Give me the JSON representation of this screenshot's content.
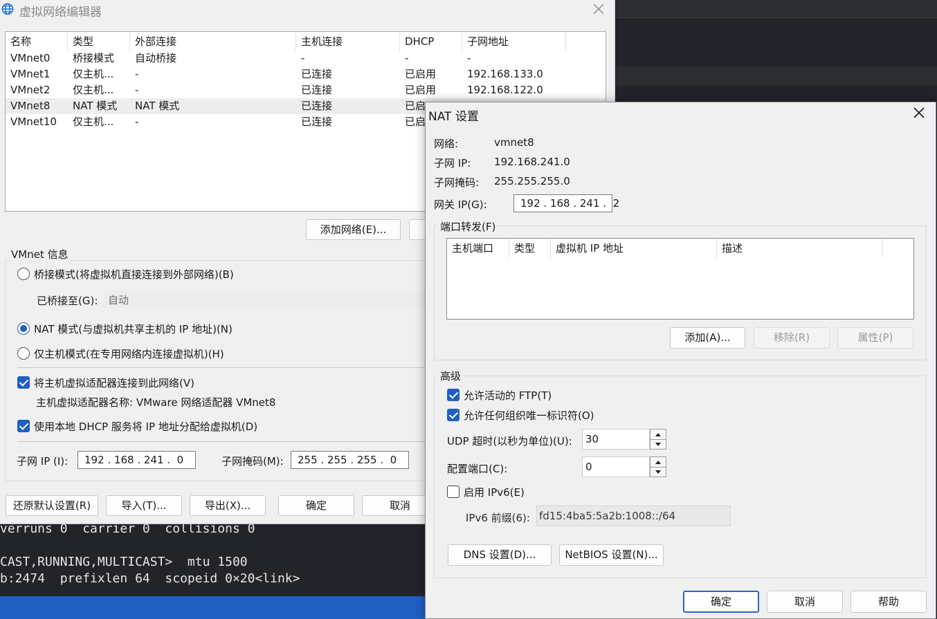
{
  "terminal": {
    "lines": [
      "verruns 0  carrier 0  collisions 0",
      "CAST,RUNNING,MULTICAST>  mtu 1500",
      "b:2474  prefixlen 64  scopeid 0×20<link>"
    ]
  },
  "vne": {
    "title": "虚拟网络编辑器",
    "icons": {
      "app": "globe-icon",
      "close": "close-icon"
    },
    "table": {
      "headers": [
        "名称",
        "类型",
        "外部连接",
        "主机连接",
        "DHCP",
        "子网地址"
      ],
      "rows": [
        [
          "VMnet0",
          "桥接模式",
          "自动桥接",
          "-",
          "-",
          "-"
        ],
        [
          "VMnet1",
          "仅主机...",
          "-",
          "已连接",
          "已启用",
          "192.168.133.0"
        ],
        [
          "VMnet2",
          "仅主机...",
          "-",
          "已连接",
          "已启用",
          "192.168.122.0"
        ],
        [
          "VMnet8",
          "NAT 模式",
          "NAT 模式",
          "已连接",
          "已启",
          ""
        ],
        [
          "VMnet10",
          "仅主机...",
          "-",
          "已连接",
          "已启",
          ""
        ]
      ],
      "selected_index": 3
    },
    "add_network_button": "添加网络(E)...",
    "info_group_label": "VMnet 信息",
    "bridged_radio": "桥接模式(将虚拟机直接连接到外部网络)(B)",
    "bridged_to_label": "已桥接至(G):",
    "bridged_to_value": "自动",
    "nat_radio": "NAT 模式(与虚拟机共享主机的 IP 地址)(N)",
    "hostonly_radio": "仅主机模式(在专用网络内连接虚拟机)(H)",
    "connect_adapter_check": "将主机虚拟适配器连接到此网络(V)",
    "adapter_name_text": "主机虚拟适配器名称: VMware 网络适配器 VMnet8",
    "dhcp_check": "使用本地 DHCP 服务将 IP 地址分配给虚拟机(D)",
    "subnet_ip_label": "子网 IP (I):",
    "subnet_ip_value": "192 . 168 . 241 .  0",
    "subnet_mask_label": "子网掩码(M):",
    "subnet_mask_value": "255 . 255 . 255 .  0",
    "bottom_buttons": {
      "restore": "还原默认设置(R)",
      "import": "导入(T)...",
      "export": "导出(X)...",
      "ok": "确定",
      "cancel": "取消"
    }
  },
  "nat": {
    "title": "NAT 设置",
    "network_label": "网络:",
    "network_value": "vmnet8",
    "subnet_ip_label": "子网 IP:",
    "subnet_ip_value": "192.168.241.0",
    "subnet_mask_label": "子网掩码:",
    "subnet_mask_value": "255.255.255.0",
    "gateway_label": "网关 IP(G):",
    "gateway_value": "192 . 168 . 241 .  2",
    "port_forward_label": "端口转发(F)",
    "pf_headers": [
      "主机端口",
      "类型",
      "虚拟机 IP 地址",
      "描述"
    ],
    "pf_add": "添加(A)...",
    "pf_remove": "移除(R)",
    "pf_props": "属性(P)",
    "advanced_label": "高级",
    "allow_ftp": "允许活动的 FTP(T)",
    "allow_oui": "允许任何组织唯一标识符(O)",
    "udp_timeout_label": "UDP 超时(以秒为单位)(U):",
    "udp_timeout_value": "30",
    "config_port_label": "配置端口(C):",
    "config_port_value": "0",
    "enable_ipv6": "启用 IPv6(E)",
    "ipv6_prefix_label": "IPv6 前缀(6):",
    "ipv6_prefix_value": "fd15:4ba5:5a2b:1008::/64",
    "dns_button": "DNS 设置(D)...",
    "netbios_button": "NetBIOS 设置(N)...",
    "ok": "确定",
    "cancel": "取消",
    "help": "帮助",
    "accent": "#1f5fc2"
  }
}
